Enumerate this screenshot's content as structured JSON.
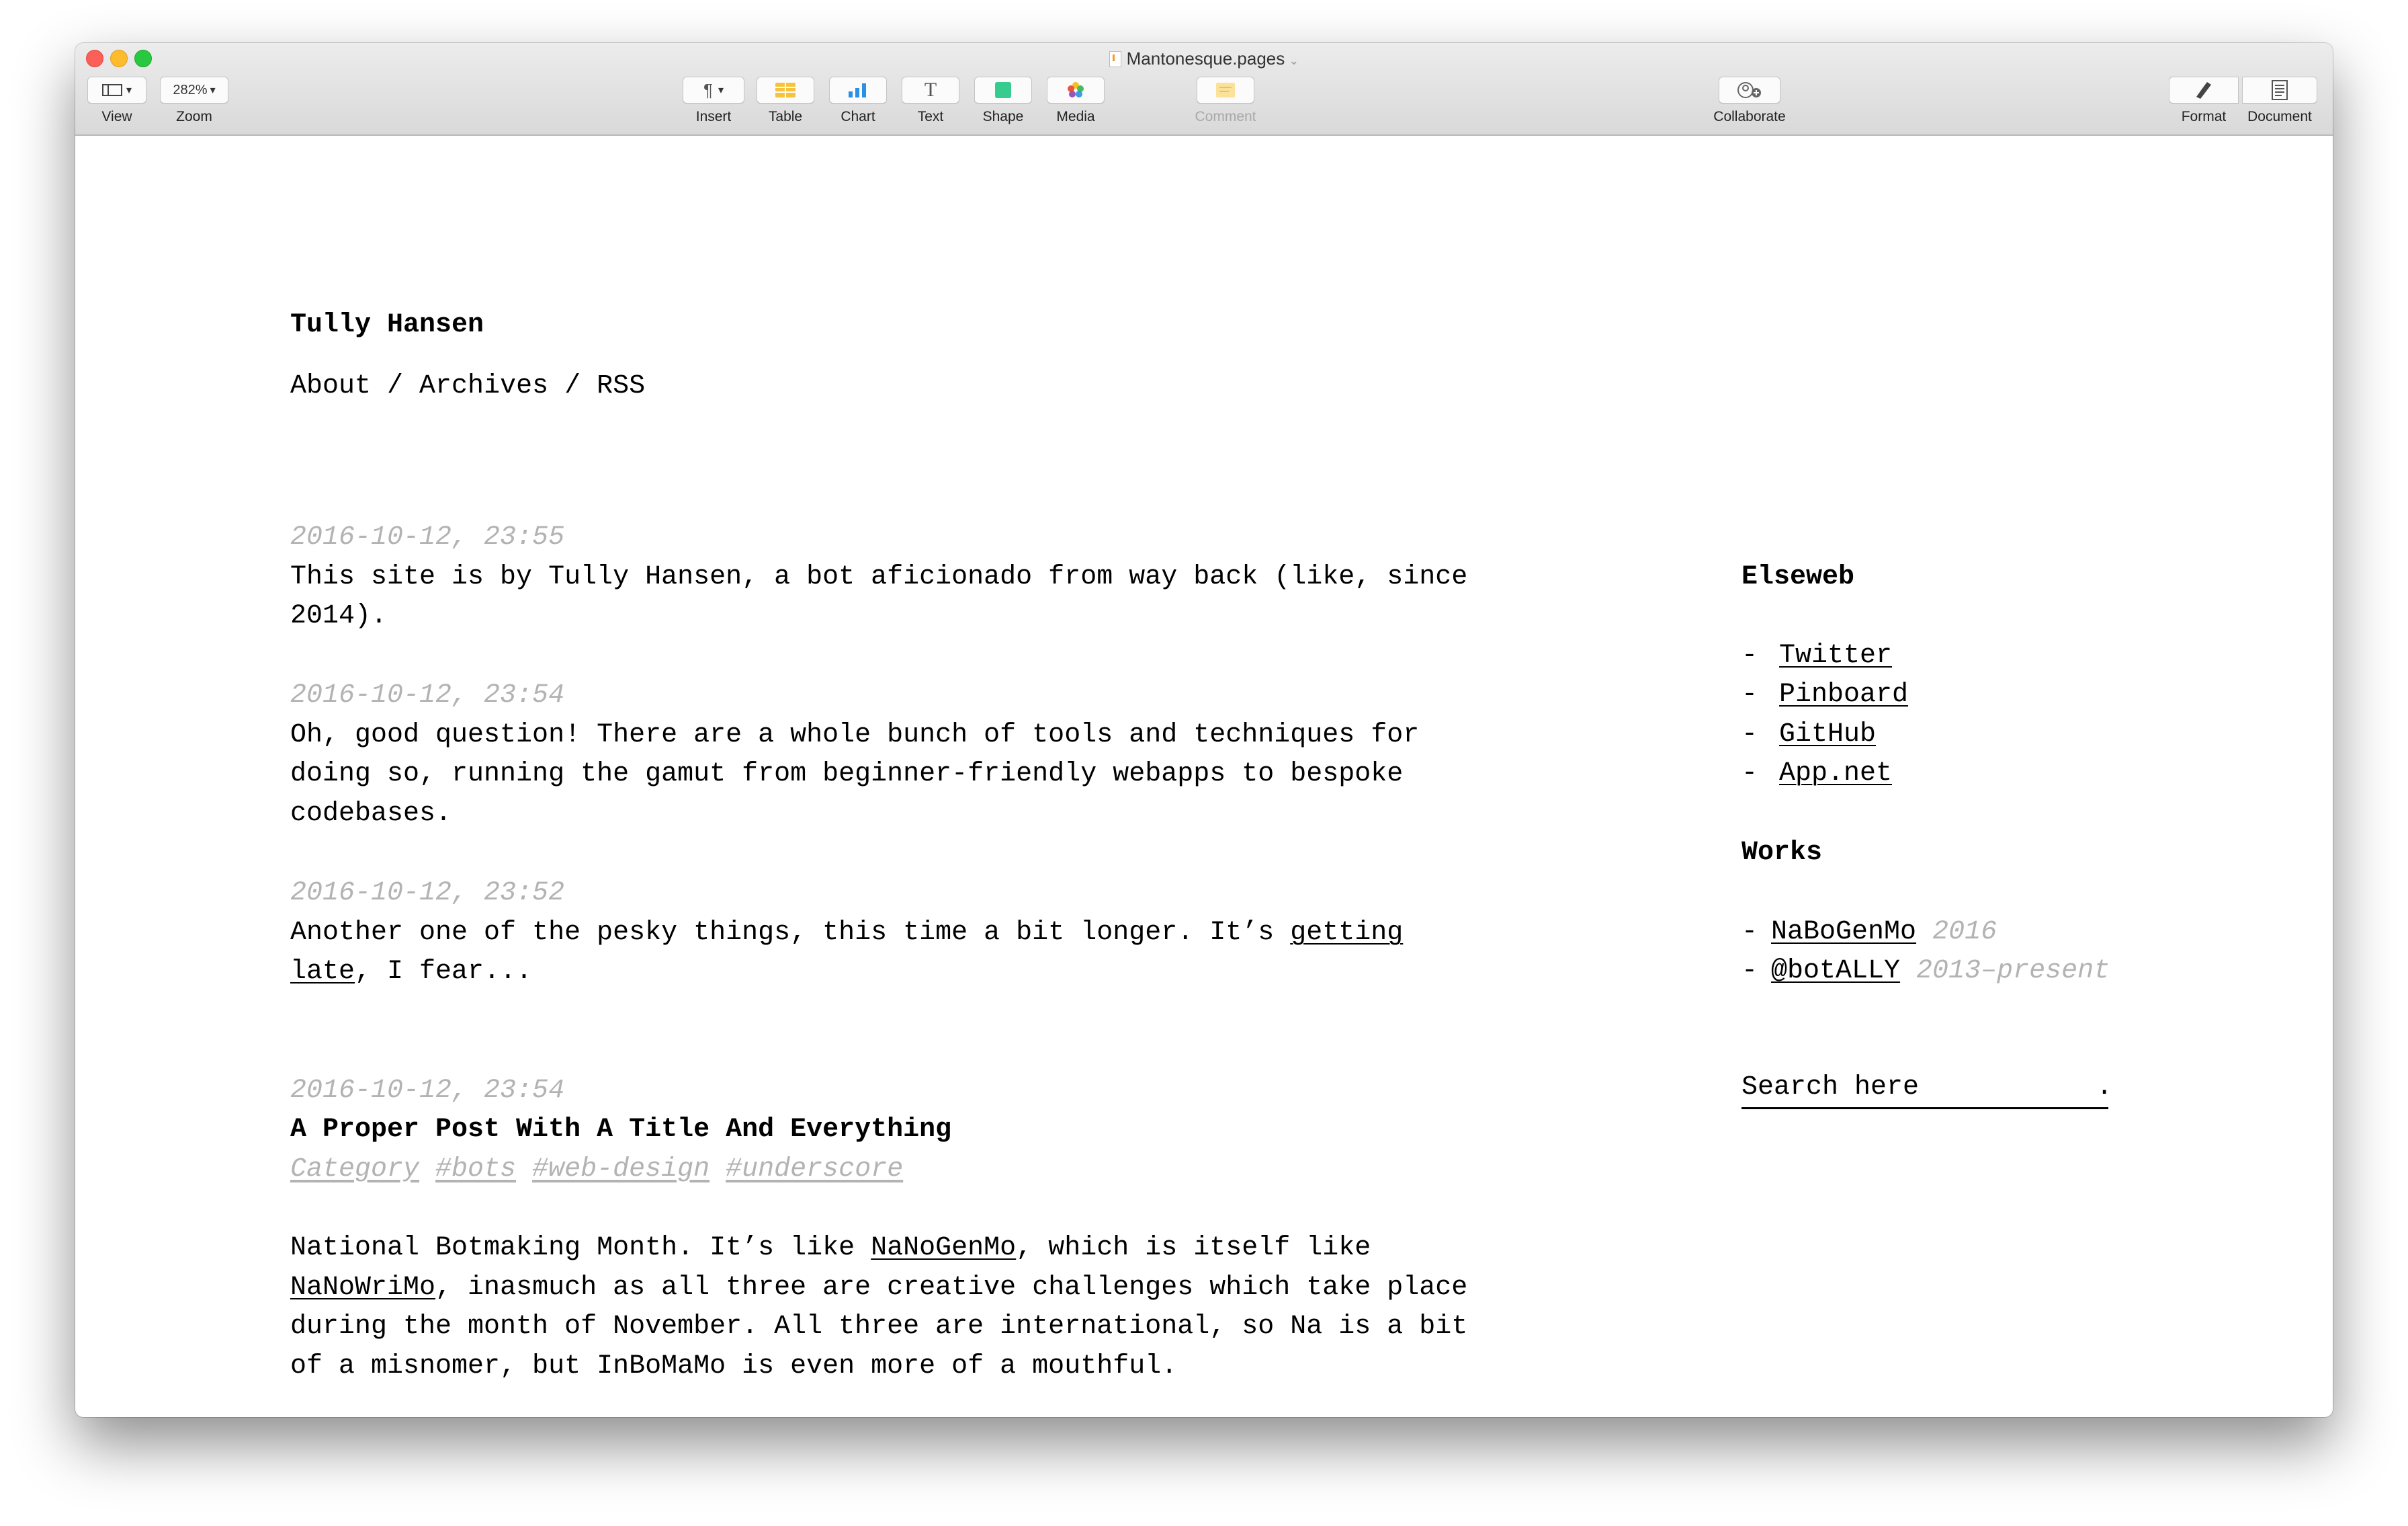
{
  "window": {
    "title": "Mantonesque.pages"
  },
  "toolbar": {
    "view_label": "View",
    "zoom_value": "282%",
    "zoom_label": "Zoom",
    "insert_label": "Insert",
    "table_label": "Table",
    "chart_label": "Chart",
    "text_label": "Text",
    "shape_label": "Shape",
    "media_label": "Media",
    "comment_label": "Comment",
    "collaborate_label": "Collaborate",
    "format_label": "Format",
    "document_label": "Document",
    "icons": [
      "sidebar-icon",
      "paragraph-icon",
      "table-icon",
      "chart-icon",
      "text-icon",
      "shape-icon",
      "media-icon",
      "comment-icon",
      "collaborate-icon",
      "format-icon",
      "document-icon"
    ]
  },
  "site": {
    "title": "Tully Hansen",
    "nav": {
      "about": "About",
      "sep1": " / ",
      "archives": "Archives",
      "sep2": " / ",
      "rss": "RSS"
    }
  },
  "posts": [
    {
      "timestamp": "2016-10-12, 23:55",
      "lines": [
        "This site is by Tully Hansen, a bot aficionado from way back (like, since",
        "2014)."
      ]
    },
    {
      "timestamp": "2016-10-12, 23:54",
      "lines": [
        "Oh, good question! There are a whole bunch of tools and techniques for",
        "doing so, running the gamut from beginner-friendly webapps to bespoke",
        "codebases."
      ]
    },
    {
      "timestamp": "2016-10-12, 23:52",
      "line1_text": "Another one of the pesky things, this time a bit longer. It’s ",
      "line1_link": "getting",
      "line2_link": "late",
      "line2_text": ", I fear..."
    },
    {
      "timestamp": "2016-10-12, 23:54",
      "title": "A Proper Post With A Title And Everything",
      "tags": [
        "Category",
        "#bots",
        "#web-design",
        "#underscore"
      ],
      "body": {
        "l1a": "National Botmaking Month. It’s like ",
        "l1link": "NaNoGenMo",
        "l1b": ", which is itself like",
        "l2link": "NaNoWriMo",
        "l2b": ", inasmuch as all three are creative challenges which take place",
        "l3": "during the month of November. All three are international, so Na is a bit",
        "l4": "of a misnomer, but InBoMaMo is even more of a mouthful."
      }
    }
  ],
  "sidebar": {
    "elseweb_heading": "Elseweb",
    "elseweb_links": [
      "Twitter",
      "Pinboard",
      "GitHub",
      "App.net"
    ],
    "works_heading": "Works",
    "works": [
      {
        "name": "NaBoGenMo",
        "meta": "2016"
      },
      {
        "name": "@botALLY",
        "meta": "2013–present"
      }
    ],
    "dash": "-",
    "search_placeholder": "Search here           ."
  },
  "colors": {
    "muted": "#b3b3b3",
    "text": "#000000",
    "chrome": "#e0e0e0"
  }
}
